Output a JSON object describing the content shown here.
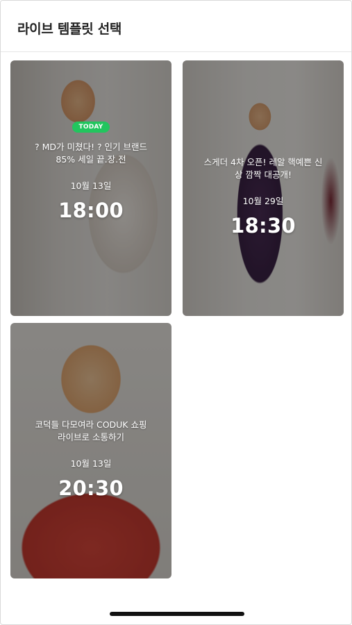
{
  "header": {
    "title": "라이브 템플릿 선택"
  },
  "templates": [
    {
      "badge": "TODAY",
      "headline_line1": "? MD가 미쳤다! ? 인기 브랜드",
      "headline_line2": "85% 세일 끝.장.전",
      "date": "10월 13일",
      "time": "18:00"
    },
    {
      "headline_line1": "스게더 4차 오픈! 레알 핵예쁜 신",
      "headline_line2": "상 깜짝 대공개!",
      "date": "10월 29일",
      "time": "18:30"
    },
    {
      "headline_line1": "코덕들 다모여라 CODUK 쇼핑",
      "headline_line2": "라이브로 소통하기",
      "date": "10월 13일",
      "time": "20:30"
    }
  ],
  "colors": {
    "badge": "#22c55e",
    "overlay": "rgba(0,0,0,0.42)",
    "home_indicator": "#111111"
  }
}
